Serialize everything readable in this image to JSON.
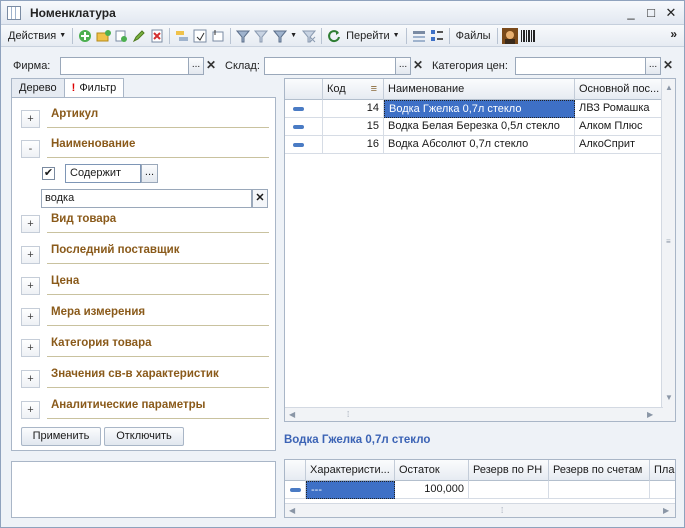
{
  "window": {
    "title": "Номенклатура",
    "controls": [
      "_",
      "□",
      "✕"
    ]
  },
  "toolbar": {
    "actions_label": "Действия",
    "goto_label": "Перейти",
    "files_label": "Файлы",
    "overflow": "»"
  },
  "filters": {
    "firm_label": "Фирма:",
    "firm_value": "",
    "warehouse_label": "Склад:",
    "warehouse_value": "",
    "price_category_label": "Категория цен:",
    "price_category_value": "",
    "select_btn": "...",
    "clear_btn": "✕"
  },
  "tabs": [
    {
      "label": "Дерево"
    },
    {
      "label": "Фильтр",
      "marker": "!"
    }
  ],
  "filter_panel": {
    "groups": [
      {
        "label": "Артикул",
        "toggle": "+"
      },
      {
        "label": "Наименование",
        "toggle": "-"
      },
      {
        "label": "Вид товара",
        "toggle": "+"
      },
      {
        "label": "Последний поставщик",
        "toggle": "+"
      },
      {
        "label": "Цена",
        "toggle": "+"
      },
      {
        "label": "Мера измерения",
        "toggle": "+"
      },
      {
        "label": "Категория товара",
        "toggle": "+"
      },
      {
        "label": "Значения св-в характеристик",
        "toggle": "+"
      },
      {
        "label": "Аналитические параметры",
        "toggle": "+"
      }
    ],
    "condition_checked": "✔",
    "condition_value": "Содержит",
    "condition_btn": "...",
    "search_value": "водка",
    "search_clear": "✕",
    "apply_label": "Применить",
    "disable_label": "Отключить"
  },
  "grid": {
    "columns": [
      {
        "label": ""
      },
      {
        "label": "Код"
      },
      {
        "label": "Наименование"
      },
      {
        "label": "Основной пос..."
      }
    ],
    "sort_marker": "≡",
    "rows": [
      {
        "code": "14",
        "name": "Водка Гжелка 0,7л стекло",
        "supplier": "ЛВЗ Ромашка",
        "selected": true
      },
      {
        "code": "15",
        "name": "Водка Белая Березка 0,5л стекло",
        "supplier": "Алком Плюс",
        "selected": false
      },
      {
        "code": "16",
        "name": "Водка Абсолют 0,7л стекло",
        "supplier": "АлкоСприт",
        "selected": false
      }
    ]
  },
  "selected_item_title": "Водка Гжелка 0,7л стекло",
  "stock_grid": {
    "columns": [
      "",
      "Характеристи...",
      "Остаток",
      "Резерв по РН",
      "Резерв по счетам",
      "Пла"
    ],
    "rows": [
      {
        "characteristic": "---",
        "remainder": "100,000",
        "reserve_rn": "",
        "reserve_invoices": "",
        "plan": ""
      }
    ]
  }
}
